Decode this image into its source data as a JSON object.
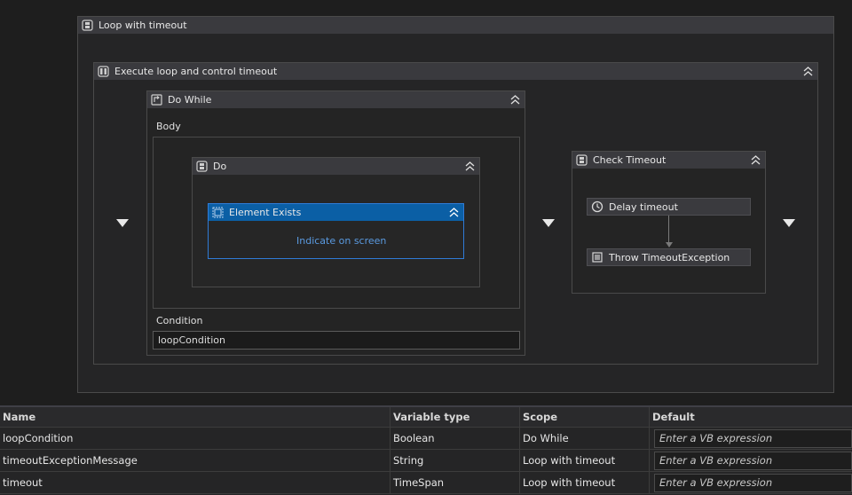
{
  "workflow": {
    "outer": {
      "title": "Loop with timeout"
    },
    "parallel": {
      "title": "Execute loop and control timeout"
    },
    "do_while": {
      "title": "Do While",
      "body_label": "Body",
      "condition_label": "Condition",
      "condition_value": "loopCondition"
    },
    "do": {
      "title": "Do"
    },
    "element_exists": {
      "title": "Element Exists",
      "link": "Indicate on screen"
    },
    "check_timeout": {
      "title": "Check Timeout",
      "steps": [
        "Delay timeout",
        "Throw TimeoutException"
      ]
    }
  },
  "variables": {
    "headers": [
      "Name",
      "Variable type",
      "Scope",
      "Default"
    ],
    "rows": [
      {
        "name": "loopCondition",
        "type": "Boolean",
        "scope": "Do While",
        "default": "Enter a VB expression"
      },
      {
        "name": "timeoutExceptionMessage",
        "type": "String",
        "scope": "Loop with timeout",
        "default": "Enter a VB expression"
      },
      {
        "name": "timeout",
        "type": "TimeSpan",
        "scope": "Loop with timeout",
        "default": "Enter a VB expression"
      }
    ]
  },
  "colors": {
    "selection": "#0b5fa5",
    "link": "#5a9ae0",
    "header": "#3a3a3e"
  },
  "icons": {
    "activity": "sequence-icon",
    "parallel": "parallel-icon",
    "loop": "do-while-icon",
    "delay": "clock-icon",
    "throw": "throw-icon",
    "collapse": "chevron-double-up-icon",
    "drop": "drop-arrow-icon"
  }
}
